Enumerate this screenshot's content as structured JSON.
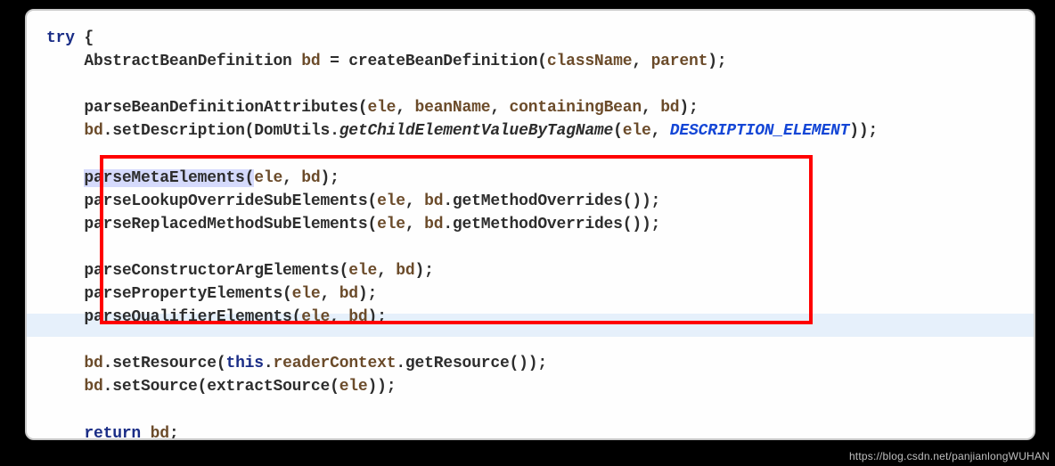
{
  "code": {
    "kw_try": "try",
    "brace_open": " {",
    "line2a": "    AbstractBeanDefinition ",
    "line2_var1": "bd",
    "line2b": " = createBeanDefinition(",
    "line2_var2": "className",
    "line2c": ", ",
    "line2_var3": "parent",
    "line2d": ");",
    "line4a": "    parseBeanDefinitionAttributes(",
    "line4_v1": "ele",
    "line4b": ", ",
    "line4_v2": "beanName",
    "line4c": ", ",
    "line4_v3": "containingBean",
    "line4d": ", ",
    "line4_v4": "bd",
    "line4e": ");",
    "line5a": "    ",
    "line5_v1": "bd",
    "line5b": ".setDescription(DomUtils.",
    "line5_m": "getChildElementValueByTagName",
    "line5c": "(",
    "line5_v2": "ele",
    "line5d": ", ",
    "line5_const": "DESCRIPTION_ELEMENT",
    "line5e": "));",
    "line7a": "    ",
    "line7_sel": "parseMetaElements(",
    "line7_v1": "ele",
    "line7b": ", ",
    "line7_v2": "bd",
    "line7c": ");",
    "line8a": "    parseLookupOverrideSubElements(",
    "line8_v1": "ele",
    "line8b": ", ",
    "line8_v2": "bd",
    "line8c": ".getMethodOverrides());",
    "line9a": "    parseReplacedMethodSubElements(",
    "line9_v1": "ele",
    "line9b": ", ",
    "line9_v2": "bd",
    "line9c": ".getMethodOverrides());",
    "line11a": "    parseConstructorArgElements(",
    "line11_v1": "ele",
    "line11b": ", ",
    "line11_v2": "bd",
    "line11c": ");",
    "line12a": "    parsePropertyElements(",
    "line12_v1": "ele",
    "line12b": ", ",
    "line12_v2": "bd",
    "line12c": ");",
    "line13a": "    parseQualifierElements(",
    "line13_v1": "ele",
    "line13b": ", ",
    "line13_v2": "bd",
    "line13c": ");",
    "line15a": "    ",
    "line15_v1": "bd",
    "line15b": ".setResource(",
    "line15_this": "this",
    "line15c": ".",
    "line15_rc": "readerContext",
    "line15d": ".getResource());",
    "line16a": "    ",
    "line16_v1": "bd",
    "line16b": ".setSource(extractSource(",
    "line16_v2": "ele",
    "line16c": "));",
    "line18a": "    ",
    "line18_ret": "return",
    "line18b": " ",
    "line18_v1": "bd",
    "line18c": ";",
    "brace_close": "}"
  },
  "watermark": "https://blog.csdn.net/panjianlongWUHAN"
}
